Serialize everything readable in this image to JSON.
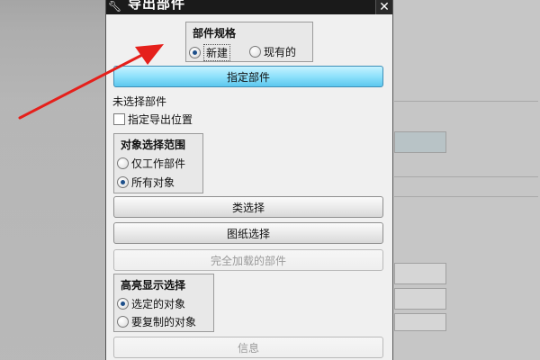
{
  "dialog": {
    "title": "导出部件",
    "title_icon": "wrench-icon",
    "close_glyph": "✕"
  },
  "part_spec": {
    "title": "部件规格",
    "options": [
      {
        "label": "新建",
        "selected": true
      },
      {
        "label": "现有的",
        "selected": false
      }
    ]
  },
  "specify_part_button": "指定部件",
  "no_part_selected_text": "未选择部件",
  "specify_export_location_checkbox": {
    "label": "指定导出位置",
    "checked": false
  },
  "object_selection_scope": {
    "title": "对象选择范围",
    "options": [
      {
        "label": "仅工作部件",
        "selected": false
      },
      {
        "label": "所有对象",
        "selected": true
      }
    ]
  },
  "class_selection_button": "类选择",
  "drawing_selection_button": "图纸选择",
  "fully_loaded_parts_button": "完全加载的部件",
  "highlight_selection": {
    "title": "高亮显示选择",
    "options": [
      {
        "label": "选定的对象",
        "selected": true
      },
      {
        "label": "要复制的对象",
        "selected": false
      }
    ]
  },
  "info_button": "信息",
  "colors": {
    "titlebar": "#1a1a1a",
    "accent_button": "#8fe1fb",
    "annotation_arrow": "#e5201b"
  }
}
